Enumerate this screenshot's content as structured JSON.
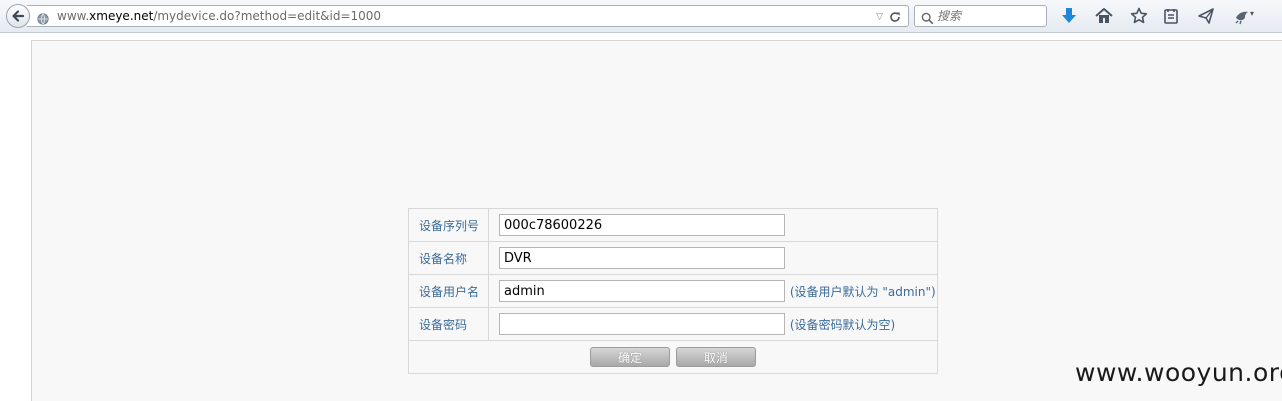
{
  "browser": {
    "url_prefix": "www.",
    "url_domain": "xmeye.net",
    "url_path": "/mydevice.do?method=edit&id=1000",
    "search_placeholder": "搜索"
  },
  "form": {
    "rows": [
      {
        "label": "设备序列号",
        "value": "000c78600226",
        "hint": ""
      },
      {
        "label": "设备名称",
        "value": "DVR",
        "hint": ""
      },
      {
        "label": "设备用户名",
        "value": "admin",
        "hint": "(设备用户默认为 \"admin\")"
      },
      {
        "label": "设备密码",
        "value": "",
        "hint": "(设备密码默认为空)"
      }
    ],
    "confirm_label": "确定",
    "cancel_label": "取消"
  },
  "watermark": "www.wooyun.org",
  "colors": {
    "label_blue": "#3a6b9a",
    "download_blue": "#1e88d6",
    "page_bg": "#f8f8f8"
  }
}
